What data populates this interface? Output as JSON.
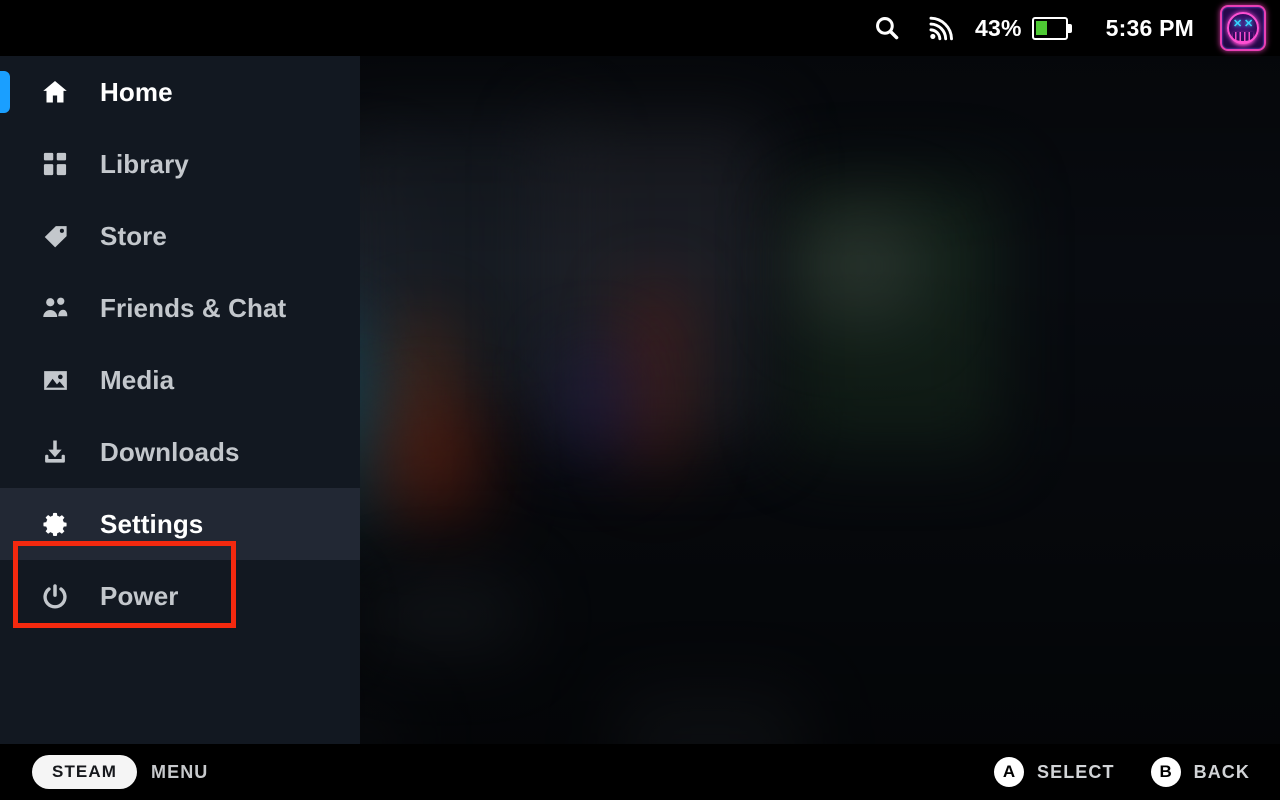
{
  "topbar": {
    "search_icon": "search-icon",
    "network_icon": "wifi-signal-icon",
    "battery_percent": "43%",
    "battery_level": 43,
    "battery_icon": "battery-icon",
    "clock": "5:36 PM",
    "avatar": "user-avatar-neon-smiley"
  },
  "sidebar": {
    "items": [
      {
        "label": "Home",
        "icon": "home-icon",
        "state": "selected"
      },
      {
        "label": "Library",
        "icon": "library-icon",
        "state": "normal"
      },
      {
        "label": "Store",
        "icon": "tag-icon",
        "state": "normal"
      },
      {
        "label": "Friends & Chat",
        "icon": "friends-icon",
        "state": "normal"
      },
      {
        "label": "Media",
        "icon": "image-icon",
        "state": "normal"
      },
      {
        "label": "Downloads",
        "icon": "download-icon",
        "state": "normal"
      },
      {
        "label": "Settings",
        "icon": "gear-icon",
        "state": "focused"
      },
      {
        "label": "Power",
        "icon": "power-icon",
        "state": "normal"
      }
    ]
  },
  "annotation": {
    "target": "Settings",
    "color": "#f4290f"
  },
  "bottombar": {
    "steam_label": "STEAM",
    "menu_label": "MENU",
    "hints": [
      {
        "glyph": "A",
        "label": "SELECT"
      },
      {
        "glyph": "B",
        "label": "BACK"
      }
    ]
  },
  "colors": {
    "accent_blue": "#1a9fff",
    "sidebar_bg": "#121821",
    "focus_bg": "#222834",
    "battery_green": "#4ec934",
    "annotation_red": "#f4290f"
  }
}
